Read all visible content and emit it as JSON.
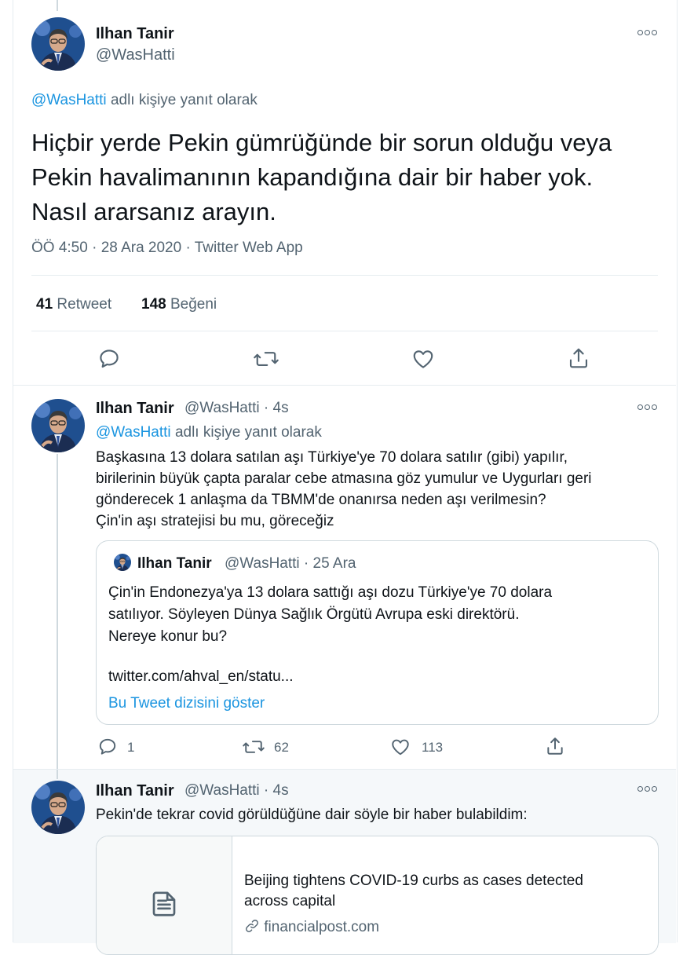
{
  "main_tweet": {
    "name": "Ilhan Tanir",
    "handle": "@WasHatti",
    "reply_handle": "@WasHatti",
    "reply_suffix": "adlı kişiye yanıt olarak",
    "lines": [
      "Hiçbir yerde Pekin gümrüğünde bir sorun olduğu veya",
      "Pekin havalimanının kapandığına dair bir haber yok.",
      "Nasıl ararsanız arayın."
    ],
    "timestamp": "ÖÖ 4:50 · 28 Ara 2020 · Twitter Web App",
    "retweet_count": "41",
    "retweet_label": "Retweet",
    "like_count": "148",
    "like_label": "Beğeni"
  },
  "reply_tweet": {
    "name": "Ilhan Tanir",
    "handle_time": "@WasHatti · 4s",
    "reply_handle": "@WasHatti",
    "reply_suffix": "adlı kişiye yanıt olarak",
    "lines": [
      "Başkasına 13 dolara satılan aşı Türkiye'ye 70 dolara satılır (gibi) yapılır,",
      "birilerinin büyük çapta paralar cebe atmasına göz yumulur ve Uygurları geri",
      "gönderecek 1 anlaşma da TBMM'de onanırsa neden aşı verilmesin?",
      "Çin'in aşı stratejisi bu mu, göreceğiz"
    ],
    "quote": {
      "name": "Ilhan Tanir",
      "handle_time": "@WasHatti · 25 Ara",
      "lines": [
        "Çin'in Endonezya'ya 13 dolara sattığı aşı dozu Türkiye'ye 70 dolara",
        "satılıyor. Söyleyen Dünya Sağlık Örgütü Avrupa eski direktörü.",
        "Nereye konur bu?"
      ],
      "link": "twitter.com/ahval_en/statu...",
      "show_thread": "Bu Tweet dizisini göster"
    },
    "reply_count": "1",
    "retweet_count": "62",
    "like_count": "113"
  },
  "third_tweet": {
    "name": "Ilhan Tanir",
    "handle_time": "@WasHatti · 4s",
    "text": "Pekin'de tekrar covid görüldüğüne dair söyle bir haber bulabildim:",
    "card": {
      "title_lines": [
        "Beijing tightens COVID-19 curbs as cases detected",
        "across capital"
      ],
      "domain": "financialpost.com"
    }
  },
  "colors": {
    "link_blue": "#1b95e0",
    "text_gray": "#536471",
    "border": "#e6ecf0",
    "highlight_bg": "#f5f8fa"
  },
  "icons": [
    "more-icon",
    "reply-icon",
    "retweet-icon",
    "like-icon",
    "share-icon",
    "article-icon",
    "link-icon"
  ]
}
